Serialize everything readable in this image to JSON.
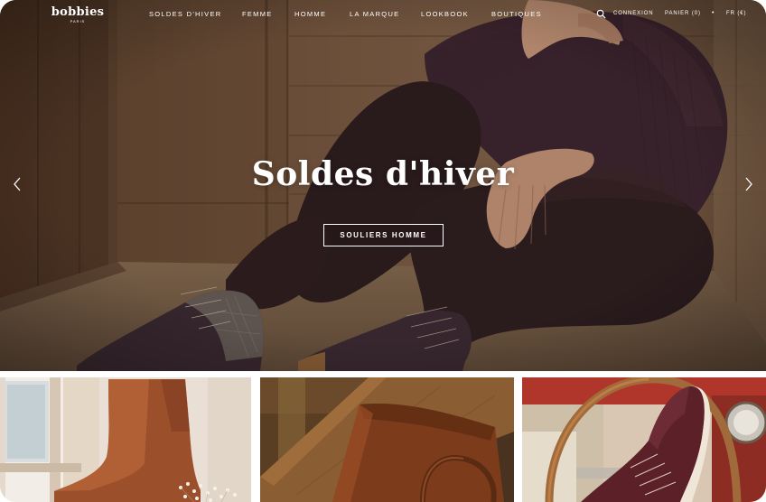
{
  "brand": {
    "name": "bobbies",
    "tagline": "PARIS"
  },
  "nav": {
    "items": [
      {
        "label": "SOLDES D'HIVER"
      },
      {
        "label": "FEMME"
      },
      {
        "label": "HOMME"
      },
      {
        "label": "LA MARQUE"
      },
      {
        "label": "LOOKBOOK"
      },
      {
        "label": "BOUTIQUES"
      }
    ]
  },
  "utility": {
    "search_icon": "search-icon",
    "login": "CONNEXION",
    "cart": "PANIER (0)",
    "separator": "•",
    "language": "FR (€)"
  },
  "hero": {
    "title": "Soldes d'hiver",
    "cta_label": "SOULIERS HOMME",
    "prev_icon": "chevron-left-icon",
    "next_icon": "chevron-right-icon"
  },
  "tiles": [
    {
      "subject": "tan ankle boot by window"
    },
    {
      "subject": "leather bag on wooden surface"
    },
    {
      "subject": "burgundy sneaker on car steering wheel"
    }
  ],
  "colors": {
    "nav_text": "#ffffff",
    "hero_overlay": "#5a3d2a"
  }
}
